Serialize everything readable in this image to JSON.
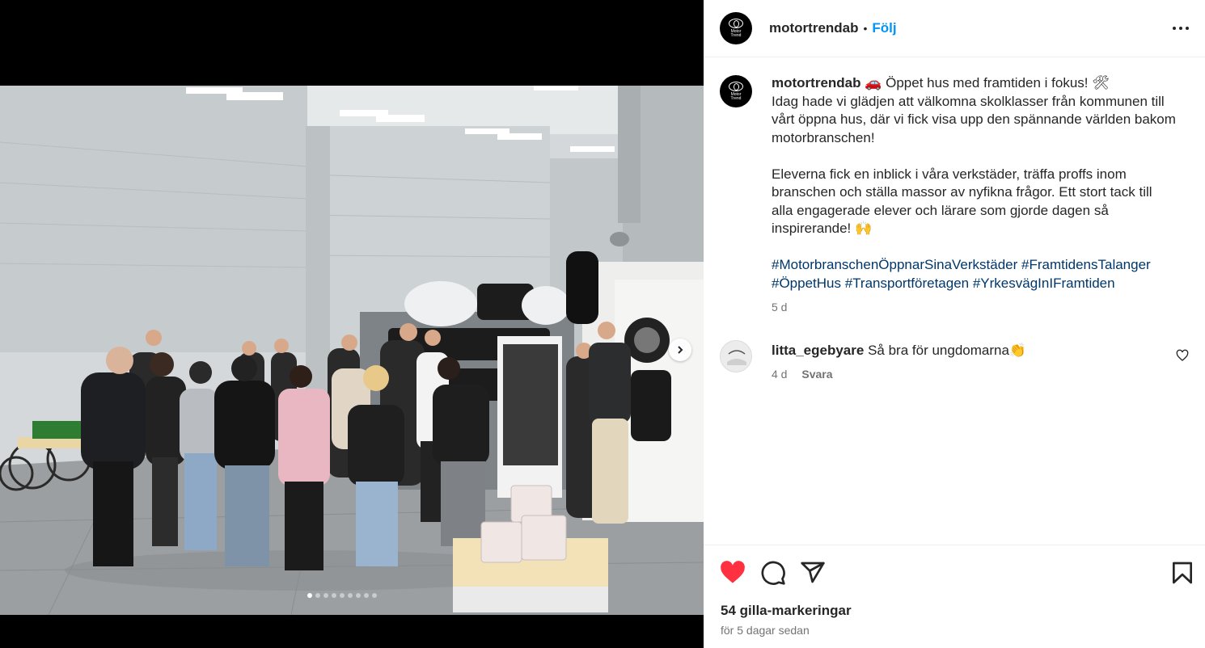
{
  "post": {
    "username": "motortrendab",
    "separator": "•",
    "follow_label": "Följ",
    "avatar_text": "Motor\nTrend",
    "caption_line1": "🚗 Öppet hus med framtiden i fokus! 🛠",
    "caption_p1": "Idag hade vi glädjen att välkomna skolklasser från kommunen till vårt öppna hus, där vi fick visa upp den spännande världen bakom motorbranschen!",
    "caption_p2": "Eleverna fick en inblick i våra verkstäder, träffa proffs inom branschen och ställa massor av nyfikna frågor. Ett stort tack till alla engagerade elever och lärare som gjorde dagen så inspirerande! 🙌",
    "hashtags": "#MotorbranschenÖppnarSinaVerkstäder #FramtidensTalanger #ÖppetHus #Transportföretagen #YrkesvägInIFramtiden",
    "time_ago": "5 d",
    "likes": "54 gilla-markeringar",
    "posted_date": "för 5 dagar sedan"
  },
  "comment": {
    "username": "litta_egebyare",
    "text": "Så bra för ungdomarna👏",
    "time_ago": "4 d",
    "reply_label": "Svara"
  },
  "carousel": {
    "total": 9,
    "active_index": 0
  },
  "icons": {
    "like": "heart-filled-icon",
    "comment": "comment-bubble-icon",
    "share": "paper-plane-icon",
    "save": "bookmark-icon",
    "more": "more-horizontal-icon",
    "next": "chevron-right-icon"
  },
  "colors": {
    "like_red": "#ff3040",
    "follow_blue": "#0095f6",
    "hashtag": "#00376b",
    "muted": "#737373"
  }
}
